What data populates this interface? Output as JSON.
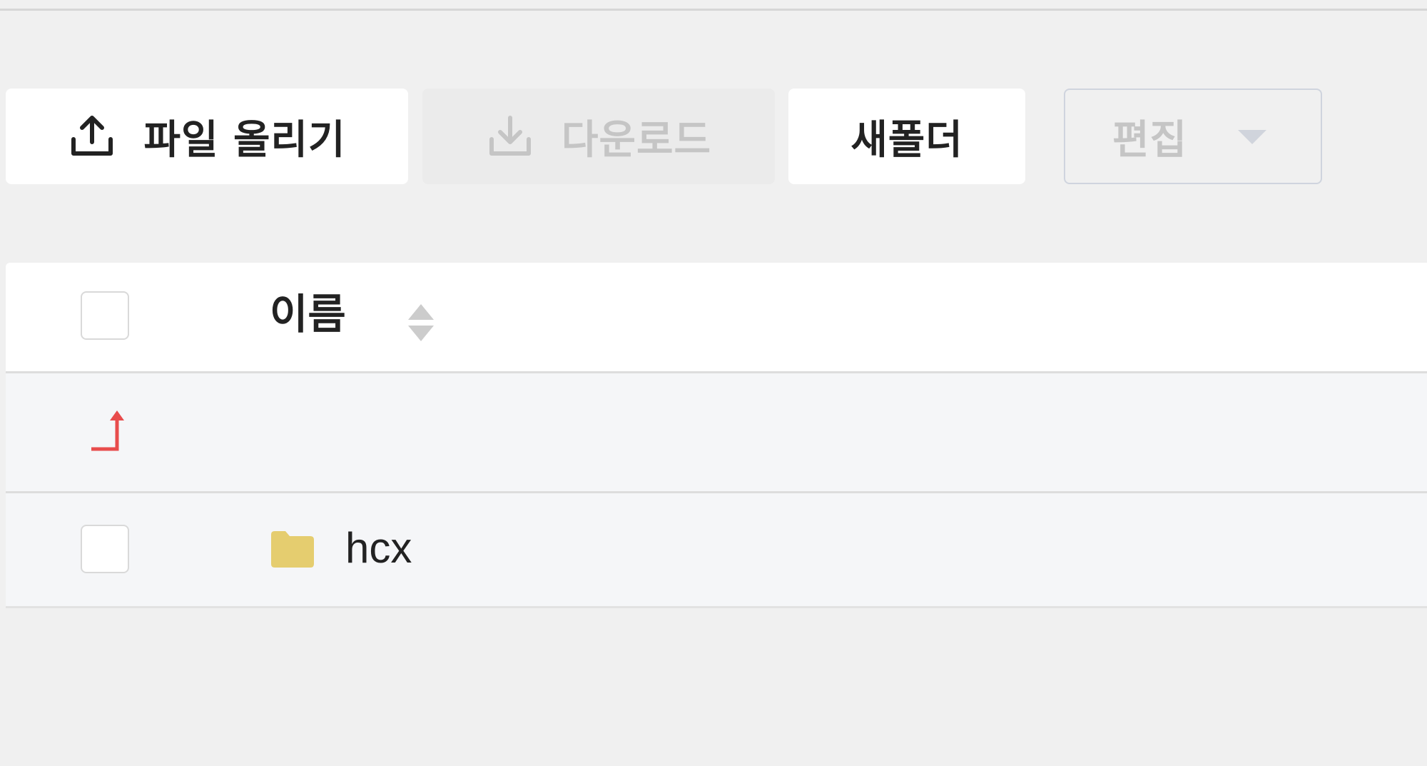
{
  "toolbar": {
    "upload_label": "파일 올리기",
    "download_label": "다운로드",
    "new_folder_label": "새폴더",
    "edit_label": "편집"
  },
  "table": {
    "header": {
      "name_label": "이름"
    },
    "rows": [
      {
        "type": "folder",
        "name": "hcx"
      }
    ]
  },
  "colors": {
    "background": "#f0f0f0",
    "up_arrow": "#e84c4c",
    "folder": "#e5cd6f",
    "disabled_text": "#c5c5c5"
  },
  "icons": {
    "upload": "upload-icon",
    "download": "download-icon",
    "edit_dropdown": "caret-down-icon",
    "sort": "sort-icon",
    "parent": "parent-folder-arrow-icon",
    "folder": "folder-icon"
  }
}
